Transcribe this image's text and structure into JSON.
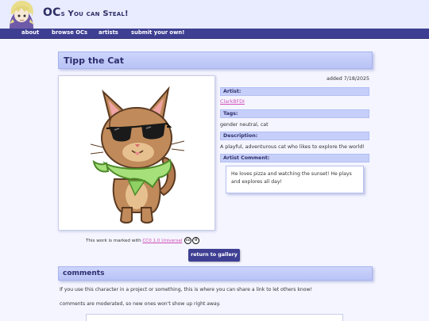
{
  "site": {
    "title_main": "OC",
    "title_rest": "s You can Steal!"
  },
  "nav": [
    {
      "label": "about"
    },
    {
      "label": "browse OCs"
    },
    {
      "label": "artists"
    },
    {
      "label": "submit your own!"
    }
  ],
  "character": {
    "name": "Tipp the Cat",
    "added": "added 7/18/2025",
    "artist_label": "Artist:",
    "artist": "ClarkBFDI",
    "tags_label": "Tags:",
    "tags": "gender neutral, cat",
    "description_label": "Description:",
    "description": "A playful, adventurous cat who likes to explore the world!",
    "comment_label": "Artist Comment:",
    "comment": "He loves pizza and watching the sunset! He plays and explores all day!"
  },
  "license": {
    "prefix": "This work is marked with",
    "link": "CC0 1.0 Universal"
  },
  "return_button": "return to gallery",
  "comments": {
    "title": "comments",
    "note1": "If you use this character in a project or something, this is where you can share a link to let others know!",
    "note2": "comments are moderated, so new ones won't show up right away."
  },
  "icons": {
    "cc": "creative-commons-icon",
    "zero": "cc-zero-icon"
  },
  "colors": {
    "nav": "#3e3f92",
    "accent_link": "#d24db6",
    "panel": "#c6cff9"
  }
}
